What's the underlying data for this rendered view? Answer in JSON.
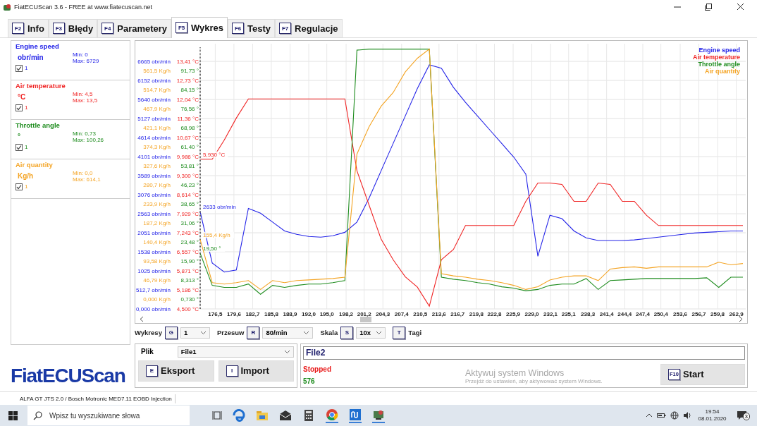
{
  "window": {
    "title": "FiatECUScan 3.6 - FREE at www.fiatecuscan.net"
  },
  "tabs": [
    {
      "key": "F2",
      "label": "Info",
      "selected": false
    },
    {
      "key": "F3",
      "label": "Błędy",
      "selected": false
    },
    {
      "key": "F4",
      "label": "Parametery",
      "selected": false
    },
    {
      "key": "F5",
      "label": "Wykres",
      "selected": true
    },
    {
      "key": "F6",
      "label": "Testy",
      "selected": false
    },
    {
      "key": "F7",
      "label": "Regulacje",
      "selected": false
    }
  ],
  "parameters": [
    {
      "name": "Engine speed",
      "unit": "obr/min",
      "min": "Min: 0",
      "max": "Max: 6729",
      "checked": true,
      "count": "1",
      "color": "#2424e8"
    },
    {
      "name": "Air temperature",
      "unit": "°C",
      "min": "Min: 4,5",
      "max": "Max: 13,5",
      "checked": true,
      "count": "1",
      "color": "#f02424"
    },
    {
      "name": "Throttle angle",
      "unit": "°",
      "min": "Min: 0,73",
      "max": "Max: 100,26",
      "checked": true,
      "count": "1",
      "color": "#1e8c1e"
    },
    {
      "name": "Air quantity",
      "unit": "Kg/h",
      "min": "Min: 0,0",
      "max": "Max: 614,1",
      "checked": true,
      "count": "1",
      "color": "#f4a424"
    }
  ],
  "logo": "FiatECUScan",
  "chart": {
    "plots": [
      {
        "chart_data": {
          "type": "line",
          "grid": true,
          "xlim": [
            174,
            264
          ],
          "ylim": [
            0,
            6665
          ],
          "x": [
            174,
            176,
            178,
            180,
            182,
            184,
            186,
            188,
            190,
            192,
            194,
            196,
            198,
            200,
            202,
            204,
            206,
            208,
            210,
            212,
            214,
            216,
            218,
            220,
            222,
            224,
            226,
            228,
            230,
            232,
            234,
            236,
            238,
            240,
            242,
            244,
            246,
            248,
            250,
            252,
            254,
            256,
            258,
            260,
            262,
            264
          ],
          "xticks": [
            {
              "value": 176.5,
              "label": "176,5"
            },
            {
              "value": 179.6,
              "label": "179,6"
            },
            {
              "value": 182.7,
              "label": "182,7"
            },
            {
              "value": 185.8,
              "label": "185,8"
            },
            {
              "value": 188.9,
              "label": "188,9"
            },
            {
              "value": 192.0,
              "label": "192,0"
            },
            {
              "value": 195.0,
              "label": "195,0"
            },
            {
              "value": 198.2,
              "label": "198,2"
            },
            {
              "value": 201.2,
              "label": "201,2"
            },
            {
              "value": 204.3,
              "label": "204,3"
            },
            {
              "value": 207.4,
              "label": "207,4"
            },
            {
              "value": 210.5,
              "label": "210,5"
            },
            {
              "value": 213.6,
              "label": "213,6"
            },
            {
              "value": 216.7,
              "label": "216,7"
            },
            {
              "value": 219.8,
              "label": "219,8"
            },
            {
              "value": 222.8,
              "label": "222,8"
            },
            {
              "value": 225.9,
              "label": "225,9"
            },
            {
              "value": 229.0,
              "label": "229,0"
            },
            {
              "value": 232.1,
              "label": "232,1"
            },
            {
              "value": 235.1,
              "label": "235,1"
            },
            {
              "value": 238.3,
              "label": "238,3"
            },
            {
              "value": 241.4,
              "label": "241,4"
            },
            {
              "value": 244.4,
              "label": "244,4"
            },
            {
              "value": 247.4,
              "label": "247,4"
            },
            {
              "value": 250.4,
              "label": "250,4"
            },
            {
              "value": 253.6,
              "label": "253,6"
            },
            {
              "value": 256.7,
              "label": "256,7"
            },
            {
              "value": 259.8,
              "label": "259,8"
            },
            {
              "value": 262.9,
              "label": "262,9"
            }
          ],
          "yticks": [
            {
              "value": 0,
              "label": "0,000 obr/min"
            },
            {
              "value": 512.7,
              "label": "512,7 obr/min"
            },
            {
              "value": 1025,
              "label": "1025 obr/min"
            },
            {
              "value": 1538,
              "label": "1538 obr/min"
            },
            {
              "value": 2051,
              "label": "2051 obr/min"
            },
            {
              "value": 2563,
              "label": "2563 obr/min"
            },
            {
              "value": 3076,
              "label": "3076 obr/min"
            },
            {
              "value": 3589,
              "label": "3589 obr/min"
            },
            {
              "value": 4101,
              "label": "4101 obr/min"
            },
            {
              "value": 4614,
              "label": "4614 obr/min"
            },
            {
              "value": 5127,
              "label": "5127 obr/min"
            },
            {
              "value": 5640,
              "label": "5640 obr/min"
            },
            {
              "value": 6152,
              "label": "6152 obr/min"
            },
            {
              "value": 6665,
              "label": "6665 obr/min"
            }
          ],
          "series": [
            {
              "name": "Engine speed",
              "color": "#2424e8",
              "values": [
                2614,
                1234,
                994,
                1049,
                2706,
                2577,
                2338,
                2099,
                2007,
                1951,
                1933,
                1970,
                2062,
                2338,
                2982,
                3719,
                4455,
                5192,
                5928,
                6572,
                6480,
                5965,
                5560,
                5192,
                4823,
                4455,
                4087,
                3627,
                1418,
                2522,
                2430,
                2099,
                1915,
                1841,
                1841,
                1841,
                1859,
                1896,
                1933,
                1970,
                2007,
                2044,
                2062,
                2080,
                2099,
                2099
              ]
            }
          ],
          "annotations": [
            {
              "text": "2633 obr/min"
            }
          ]
        }
      },
      {
        "chart_data": {
          "type": "line",
          "ylim": [
            4.5,
            13.41
          ],
          "yticks": [
            {
              "value": 4.5,
              "label": "4,500 °C"
            },
            {
              "value": 5.186,
              "label": "5,186 °C"
            },
            {
              "value": 5.871,
              "label": "5,871 °C"
            },
            {
              "value": 6.557,
              "label": "6,557 °C"
            },
            {
              "value": 7.243,
              "label": "7,243 °C"
            },
            {
              "value": 7.929,
              "label": "7,929 °C"
            },
            {
              "value": 8.614,
              "label": "8,614 °C"
            },
            {
              "value": 9.3,
              "label": "9,300 °C"
            },
            {
              "value": 9.986,
              "label": "9,986 °C"
            },
            {
              "value": 10.67,
              "label": "10,67 °C"
            },
            {
              "value": 11.36,
              "label": "11,36 °C"
            },
            {
              "value": 12.04,
              "label": "12,04 °C"
            },
            {
              "value": 12.73,
              "label": "12,73 °C"
            },
            {
              "value": 13.41,
              "label": "13,41 °C"
            }
          ],
          "series": [
            {
              "name": "Air temperature",
              "color": "#f02424",
              "values": [
                9.89,
                9.89,
                10.58,
                11.37,
                12.06,
                12.06,
                12.06,
                12.06,
                12.06,
                12.06,
                12.06,
                12.06,
                12.06,
                9.47,
                8.24,
                7.01,
                6.27,
                5.66,
                5.29,
                4.6,
                6.27,
                6.64,
                7.5,
                7.5,
                7.5,
                7.5,
                7.5,
                8.37,
                9.03,
                9.03,
                8.98,
                8.37,
                8.37,
                9.03,
                8.98,
                8.37,
                8.37,
                7.87,
                7.5,
                7.5,
                7.5,
                7.5,
                7.5,
                7.5,
                7.5,
                7.5
              ]
            }
          ],
          "annotations": [
            {
              "text": "5,930 °C"
            }
          ]
        }
      },
      {
        "chart_data": {
          "type": "line",
          "ylim": [
            -3.2,
            101
          ],
          "yticks": [
            {
              "value": 0.73,
              "label": "0,730 °"
            },
            {
              "value": 8.313,
              "label": "8,313 °"
            },
            {
              "value": 15.9,
              "label": "15,90 °"
            },
            {
              "value": 23.48,
              "label": "23,48 °"
            },
            {
              "value": 31.06,
              "label": "31,06 °"
            },
            {
              "value": 38.65,
              "label": "38,65 °"
            },
            {
              "value": 46.23,
              "label": "46,23 °"
            },
            {
              "value": 53.81,
              "label": "53,81 °"
            },
            {
              "value": 61.4,
              "label": "61,40 °"
            },
            {
              "value": 68.98,
              "label": "68,98 °"
            },
            {
              "value": 76.56,
              "label": "76,56 °"
            },
            {
              "value": 84.15,
              "label": "84,15 °"
            },
            {
              "value": 91.73,
              "label": "91,73 °"
            }
          ],
          "series": [
            {
              "name": "Throttle angle",
              "color": "#1e8c1e",
              "values": [
                18.97,
                6.18,
                5.36,
                5.36,
                6.72,
                2.64,
                6.18,
                5.36,
                6.18,
                6.72,
                6.72,
                7.27,
                8.08,
                99.85,
                100.26,
                100.26,
                100.26,
                100.26,
                100.26,
                100.26,
                9.44,
                8.63,
                8.08,
                7.27,
                6.72,
                5.63,
                5.09,
                4.0,
                4.54,
                6.18,
                6.72,
                6.72,
                8.9,
                4.54,
                8.08,
                8.35,
                8.63,
                8.9,
                8.9,
                8.9,
                8.9,
                8.9,
                9.17,
                5.36,
                9.44,
                9.44
              ]
            }
          ],
          "annotations": [
            {
              "text": "19,50 °"
            }
          ]
        }
      },
      {
        "chart_data": {
          "type": "line",
          "ylim": [
            -24.3,
            620
          ],
          "yticks": [
            {
              "value": 0,
              "label": "0,000 Kg/h"
            },
            {
              "value": 46.79,
              "label": "46,79 Kg/h"
            },
            {
              "value": 93.58,
              "label": "93,58 Kg/h"
            },
            {
              "value": 140.4,
              "label": "140,4 Kg/h"
            },
            {
              "value": 187.2,
              "label": "187,2 Kg/h"
            },
            {
              "value": 233.9,
              "label": "233,9 Kg/h"
            },
            {
              "value": 280.7,
              "label": "280,7 Kg/h"
            },
            {
              "value": 327.6,
              "label": "327,6 Kg/h"
            },
            {
              "value": 374.3,
              "label": "374,3 Kg/h"
            },
            {
              "value": 421.1,
              "label": "421,1 Kg/h"
            },
            {
              "value": 467.9,
              "label": "467,9 Kg/h"
            },
            {
              "value": 514.7,
              "label": "514,7 Kg/h"
            },
            {
              "value": 561.5,
              "label": "561,5 Kg/h"
            }
          ],
          "series": [
            {
              "name": "Air quantity",
              "color": "#f4a424",
              "values": [
                146.2,
                40.3,
                37.0,
                40.3,
                45.4,
                23.5,
                45.4,
                40.3,
                45.4,
                47.0,
                48.7,
                50.4,
                53.8,
                356.2,
                423.4,
                473.8,
                507.4,
                557.8,
                591.4,
                614.1,
                62.2,
                57.1,
                53.8,
                48.7,
                45.4,
                40.3,
                33.6,
                23.5,
                30.2,
                47.0,
                53.8,
                57.1,
                57.1,
                45.4,
                73.9,
                77.3,
                79.0,
                75.6,
                79.0,
                79.0,
                79.0,
                79.0,
                79.0,
                90.7,
                84.0,
                87.4
              ]
            }
          ],
          "annotations": [
            {
              "text": "155,4 Kg/h"
            }
          ]
        }
      }
    ]
  },
  "toolbar": [
    {
      "kind": "select",
      "label": "Wykresy",
      "key": "G",
      "value": "1"
    },
    {
      "kind": "select",
      "label": "Przesuw",
      "key": "R",
      "value": "80/min"
    },
    {
      "kind": "select",
      "label": "Skala",
      "key": "S",
      "value": "10x"
    },
    {
      "kind": "key",
      "label": "Tagi",
      "key": "T"
    }
  ],
  "file_panel": {
    "label": "Plik",
    "value": "File1",
    "buttons": [
      {
        "key": "E",
        "label": "Eksport"
      },
      {
        "key": "I",
        "label": "Import"
      }
    ]
  },
  "session": {
    "file": "File2",
    "state": "Stopped",
    "count": "576",
    "start": {
      "key": "F10",
      "label": "Start"
    }
  },
  "activation": {
    "title": "Aktywuj system Windows",
    "hint": "Przejdź do ustawień, aby aktywować system Windows."
  },
  "status_bar": "ALFA GT JTS 2.0 / Bosch Motronic MED7.11 EOBD Injection",
  "taskbar": {
    "search_placeholder": "Wpisz tu wyszukiwane słowa",
    "time": "19:54",
    "date": "08.01.2020",
    "notifications": "3"
  }
}
